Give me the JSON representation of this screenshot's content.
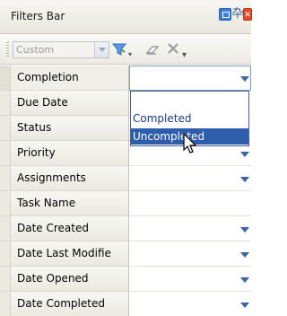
{
  "panel": {
    "title": "Filters Bar"
  },
  "window_buttons": {
    "pin_glyph": "卆",
    "close_glyph": "✕"
  },
  "toolbar": {
    "filter_combo_value": "Custom",
    "icons": [
      "funnel-icon",
      "eraser-icon",
      "clear-x-icon",
      "more-chevron-icon"
    ]
  },
  "filters": [
    {
      "label": "Completion",
      "has_dropdown": true,
      "selected": true
    },
    {
      "label": "Due Date",
      "has_dropdown": false
    },
    {
      "label": "Status",
      "has_dropdown": false
    },
    {
      "label": "Priority",
      "has_dropdown": true
    },
    {
      "label": "Assignments",
      "has_dropdown": true
    },
    {
      "label": "Task Name",
      "has_dropdown": false
    },
    {
      "label": "Date Created",
      "has_dropdown": true
    },
    {
      "label": "Date Last Modifie",
      "has_dropdown": true
    },
    {
      "label": "Date Opened",
      "has_dropdown": true
    },
    {
      "label": "Date Completed",
      "has_dropdown": true
    }
  ],
  "dropdown": {
    "options": [
      "Completed",
      "Uncompleted"
    ],
    "highlighted_index": 1
  },
  "colors": {
    "highlight": "#2e5dab",
    "arrow": "#3a64a8",
    "close": "#e24b26"
  }
}
